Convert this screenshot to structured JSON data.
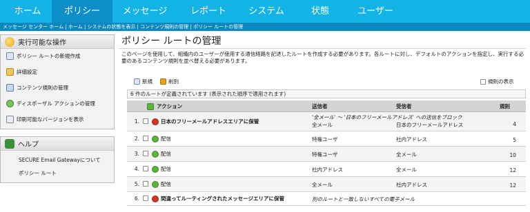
{
  "nav": {
    "tabs": [
      {
        "label": "ホーム",
        "active": false
      },
      {
        "label": "ポリシー",
        "active": true
      },
      {
        "label": "メッセージ",
        "active": false
      },
      {
        "label": "レポート",
        "active": false
      },
      {
        "label": "システム",
        "active": false
      },
      {
        "label": "状態",
        "active": false
      },
      {
        "label": "ユーザー",
        "active": false
      }
    ]
  },
  "breadcrumb": {
    "items": [
      "メッセージ センター ホーム",
      "ホーム",
      "システムの状態を表示",
      "コンテンツ規則の管理",
      "ポリシー ルートの管理"
    ],
    "separator": " | "
  },
  "sidebar": {
    "actions": {
      "title": "実行可能な操作",
      "items": [
        "ポリシー ルートの新規作成",
        "詳細設定",
        "コンテンツ規則の管理",
        "ディスポーザル アクションの管理",
        "印刷可能なバージョンを表示"
      ]
    },
    "help": {
      "title": "ヘルプ",
      "items": [
        "SECURE Email Gatewayについて",
        "ポリシー ルート"
      ]
    }
  },
  "main": {
    "title": "ポリシー ルートの管理",
    "description": "このページを使用して、組織内のユーザーが使用する通信経路を記述したルートを作成する必要があります。各ルートに対し、デフォルトのアクションを指定し、実行する必要のあるコンテンツ規則を並べ替える必要があります。",
    "toolbar": {
      "new_label": "新規",
      "delete_label": "削別",
      "show_rules_label": "規則の表示"
    },
    "count_text": "6 件のルートが定義されています (表示された順序で適用されます)",
    "table": {
      "headers": {
        "action": "アクション",
        "sender": "送信者",
        "recipient": "受信者",
        "rules": "規則"
      },
      "rows": [
        {
          "index": "1.",
          "status": "block",
          "action": "日本のフリーメールアドレスエリアに保管",
          "sender": "全メール",
          "recipient": "日本のフリーメールアドレス",
          "rules": "4",
          "note": "'全メール' ～ '日本のフリーメールアドレス' への送信をブロック"
        },
        {
          "index": "2.",
          "status": "ok",
          "action": "配信",
          "sender": "特権ユーザ",
          "recipient": "社内アドレス",
          "rules": "5",
          "note": ""
        },
        {
          "index": "3.",
          "status": "ok",
          "action": "配信",
          "sender": "特権ユーザ",
          "recipient": "全メール",
          "rules": "10",
          "note": ""
        },
        {
          "index": "4.",
          "status": "ok",
          "action": "配信",
          "sender": "社内アドレス",
          "recipient": "全メール",
          "rules": "12",
          "note": ""
        },
        {
          "index": "5.",
          "status": "ok",
          "action": "配信",
          "sender": "全メール",
          "recipient": "社内アドレス",
          "rules": "12",
          "note": ""
        },
        {
          "index": "6.",
          "status": "block",
          "action": "間違ってルーティングされたメッセージエリアに保管",
          "sender": "",
          "recipient": "",
          "rules": "",
          "note": "別のルートと一致しないすべての電子メール"
        }
      ]
    }
  },
  "colors": {
    "nav_bg": "#14b3e6",
    "nav_active": "#0f8fc8",
    "breadcrumb_bg": "#0c86bf",
    "status_block": "#d9322c",
    "status_ok": "#5cb43c"
  }
}
